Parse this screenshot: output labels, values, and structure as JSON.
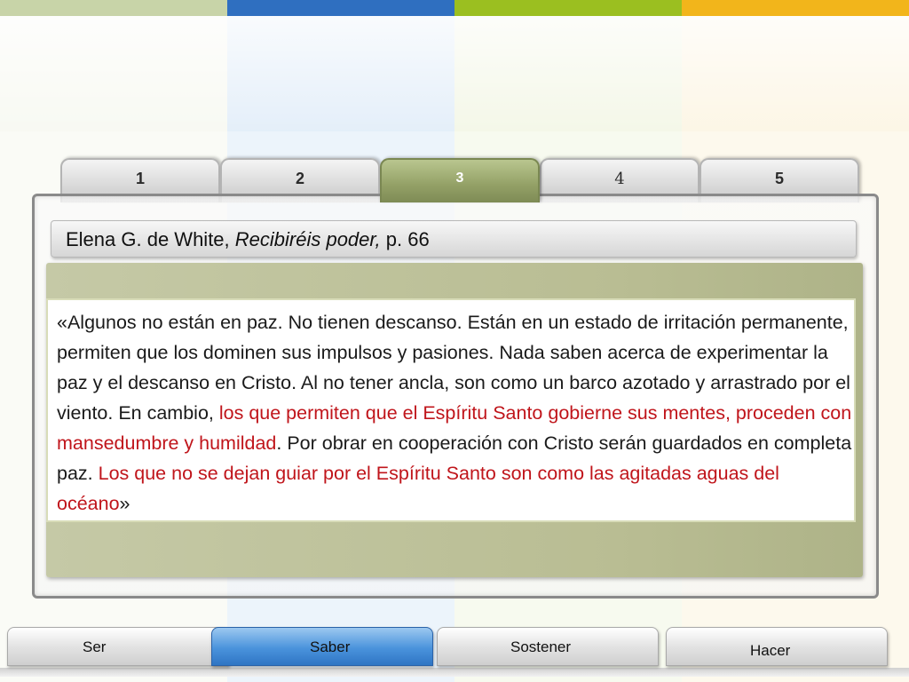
{
  "background": {
    "stripe_colors": [
      "#c8d4a8",
      "#2f6fc0",
      "#9bbf20",
      "#f2b51b"
    ],
    "column_colors": [
      "#f4f6ec",
      "#d6e6f6",
      "#eef3dc",
      "#fbf1d8"
    ]
  },
  "tabs": [
    {
      "label": "1",
      "active": false
    },
    {
      "label": "2",
      "active": false
    },
    {
      "label": "3",
      "active": true
    },
    {
      "label": "4",
      "active": false
    },
    {
      "label": "5",
      "active": false
    }
  ],
  "source": {
    "author": "Elena G. de White, ",
    "book": "Recibiréis poder,",
    "page": " p. 66"
  },
  "quote": {
    "part1": "«Algunos no están en paz. No tienen descanso. Están en un estado de irritación permanente, permiten que los dominen sus impulsos y pasiones. Nada saben acerca de experimentar la paz y el descanso en Cristo. Al no tener ancla, son como un barco azotado y arrastrado por el viento. En cambio, ",
    "highlight1": "los que permiten que el Espíritu Santo gobierne sus mentes, proceden con mansedumbre y humildad",
    "part2": ". Por obrar en cooperación con Cristo serán guardados en completa paz. ",
    "highlight2": "Los que no se dejan guiar por el Espíritu Santo son como las agitadas aguas del océano",
    "part3": "»",
    "highlight_color": "#c0151b"
  },
  "bottom_nav": [
    {
      "label": "Ser",
      "active": false
    },
    {
      "label": "Saber",
      "active": true
    },
    {
      "label": "Sostener",
      "active": false
    },
    {
      "label": "Hacer",
      "active": false
    }
  ]
}
